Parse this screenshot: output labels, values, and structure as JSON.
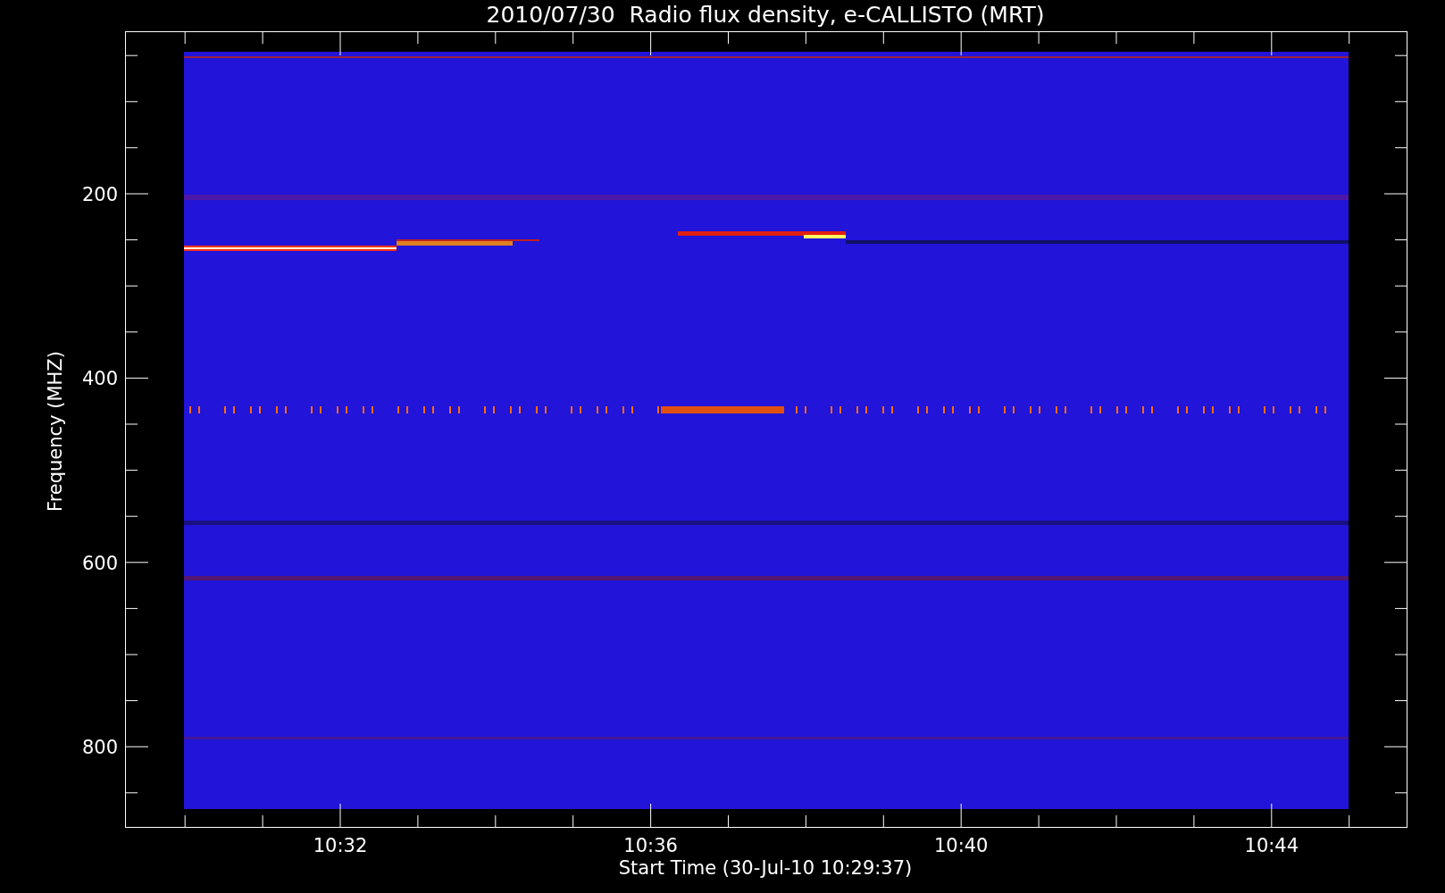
{
  "title": "2010/07/30  Radio flux density, e-CALLISTO (MRT)",
  "ylabel": "Frequency (MHZ)",
  "xlabel": "Start Time (30-Jul-10 10:29:37)",
  "yticks": [
    "200",
    "400",
    "600",
    "800"
  ],
  "xticks": [
    "10:32",
    "10:36",
    "10:40",
    "10:44"
  ]
}
